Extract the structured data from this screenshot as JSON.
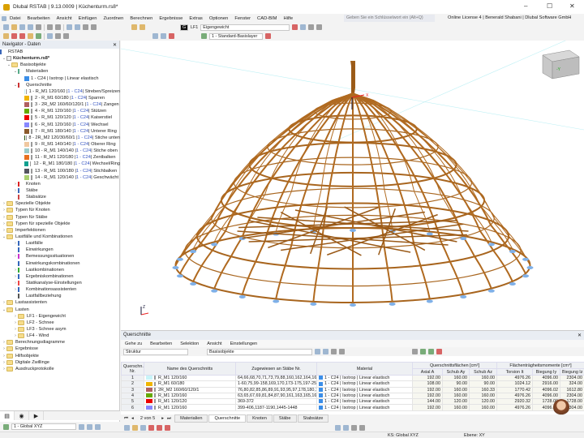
{
  "title": "Dlubal RSTAB | 9.13.0009 | Küchenturm.rs8*",
  "menu": [
    "Datei",
    "Bearbeiten",
    "Ansicht",
    "Einfügen",
    "Zuordnen",
    "Berechnen",
    "Ergebnisse",
    "Extras",
    "Optionen",
    "Fenster",
    "CAD-BIM",
    "Hilfe"
  ],
  "search_placeholder": "Geben Sie ein Schlüsselwort ein (Alt+Q)",
  "license": "Online License 4 | Benerald Shabani | Dlubal Software GmbH",
  "toolbar": {
    "lc_tag": "G",
    "lc": "LF1",
    "lc_name": "Eigengewicht",
    "layer": "1 - Standard-Basislayer"
  },
  "navigator": {
    "title": "Navigator - Daten",
    "root": "RSTAB",
    "file": "Küchenturm.rs8*",
    "basis": "Basisobjekte",
    "materialien": "Materialien",
    "material1": "1 - C24 | Isotrop | Linear elastisch",
    "querschnitte": "Querschnitte",
    "sections": [
      {
        "pre": "1 - R_M1 120/160 | ",
        "mat": "1 - C24",
        "post": " | Streben/Spreizen",
        "color": "#c8f4f8"
      },
      {
        "pre": "2 - R_M1 60/180 | ",
        "mat": "1 - C24",
        "post": " | Sparren",
        "color": "#f0b400"
      },
      {
        "pre": "3 - 2R_M2 160/60/120/1 | ",
        "mat": "1 - C24",
        "post": " | Zangen",
        "color": "#b06060"
      },
      {
        "pre": "4 - R_M1 120/160 | ",
        "mat": "1 - C24",
        "post": " | Stützen",
        "color": "#66aa00"
      },
      {
        "pre": "5 - R_M1 120/120 | ",
        "mat": "1 - C24",
        "post": " | Kaiserstiel",
        "color": "#ee0000"
      },
      {
        "pre": "6 - R_M1 120/160 | ",
        "mat": "1 - C24",
        "post": " | Wechsel",
        "color": "#8888ff"
      },
      {
        "pre": "7 - R_M1 180/140 | ",
        "mat": "1 - C24",
        "post": " | Unterer Ring",
        "color": "#8b5a2b"
      },
      {
        "pre": "8 - 2R_M2 120/30/60/1 | ",
        "mat": "1 - C24",
        "post": " | Stiche unten",
        "color": "#2a5a10"
      },
      {
        "pre": "9 - R_M1 140/140 | ",
        "mat": "1 - C24",
        "post": " | Oberer Ring",
        "color": "#f0c8a0"
      },
      {
        "pre": "10 - R_M1 140/140 | ",
        "mat": "1 - C24",
        "post": " | Stiche oben",
        "color": "#99cccc"
      },
      {
        "pre": "11 - R_M1 120/180 | ",
        "mat": "1 - C24",
        "post": " | Zentbalken",
        "color": "#e87020"
      },
      {
        "pre": "12 - R_M1 180/180 | ",
        "mat": "1 - C24",
        "post": " | Wechsel/Ring",
        "color": "#10a090"
      },
      {
        "pre": "13 - R_M1 100/180 | ",
        "mat": "1 - C24",
        "post": " | Stichbalken",
        "color": "#555560"
      },
      {
        "pre": "14 - R_M1 120/140 | ",
        "mat": "1 - C24",
        "post": " | Geschwächt",
        "color": "#aad070"
      }
    ],
    "knoten": "Knoten",
    "staebe": "Stäbe",
    "stabsaetze": "Stabsätze",
    "folders1": [
      "Spezielle Objekte",
      "Typen für Knoten",
      "Typen für Stäbe",
      "Typen für spezielle Objekte",
      "Imperfektionen",
      "Lastfälle und Kombinationen"
    ],
    "lk_items": [
      "Lastfälle",
      "Einwirkungen",
      "Bemessungssituationen",
      "Einwirkungskombinationen",
      "Lastkombinationen",
      "Ergebniskombinationen",
      "Statikanalyse-Einstellungen",
      "Kombinationsassistenten",
      "Lastfallbeziehung"
    ],
    "lastassistenten": "Lastassistenten",
    "lasten": "Lasten",
    "lasten_items": [
      "LF1 - Eigengewicht",
      "LF2 - Schnee",
      "LF3 - Schnee asym",
      "LF4 - Wind"
    ],
    "folders2": [
      "Berechnungsdiagramme",
      "Ergebnisse",
      "Hilfsobjekte",
      "Digitale Zwillinge",
      "Ausdruckprotokolle"
    ],
    "cs": "1 - Global XYZ"
  },
  "viewport": {
    "cube_y": "-Y",
    "axis_x": "X",
    "axis_z": "Z"
  },
  "panel": {
    "title": "Querschnitte",
    "menu": [
      "Gehe zu",
      "Bearbeiten",
      "Selektion",
      "Ansicht",
      "Einstellungen"
    ],
    "combo1": "Struktur",
    "combo2": "Basisobjekte",
    "headers": {
      "nr": "Querschn. Nr.",
      "name": "Name des Querschnitts",
      "assigned": "Zugewiesen an Stäbe Nr.",
      "material": "Material",
      "areas": "Querschnittsflächen [cm²]",
      "axial": "Axial A",
      "shear_y": "Schub Ay",
      "shear_z": "Schub Az",
      "moments": "Flächenträgheitsmomente [cm⁴]",
      "torsion": "Torsion It",
      "bend_y": "Biegung Iy",
      "bend_z": "Biegung Iz"
    },
    "rows": [
      {
        "nr": "1",
        "color": "#c8f4f8",
        "name": "R_M1 120/160",
        "assigned": "64,66,68,70,71,73,79,88,160,162,164,166...",
        "material": "1 - C24 | Isotrop | Linear elastisch",
        "A": "192.00",
        "Ay": "160.00",
        "Az": "160.00",
        "It": "4976.26",
        "Iy": "4096.00",
        "Iz": "2304.00"
      },
      {
        "nr": "2",
        "color": "#f0b400",
        "name": "R_M1 60/180",
        "assigned": "1-60,75,99-158,169,170,173-175,197-256...",
        "material": "1 - C24 | Isotrop | Linear elastisch",
        "A": "108.00",
        "Ay": "90.00",
        "Az": "90.00",
        "It": "1024.12",
        "Iy": "2916.00",
        "Iz": "324.00"
      },
      {
        "nr": "3",
        "color": "#b06060",
        "name": "2R_M2 160/60/120/1",
        "assigned": "76,80,82,85,86,89,91,93,95,97,178,180,1...",
        "material": "1 - C24 | Isotrop | Linear elastisch",
        "A": "192.00",
        "Ay": "160.00",
        "Az": "160.33",
        "It": "1770.42",
        "Iy": "4096.02",
        "Iz": "1612.80"
      },
      {
        "nr": "4",
        "color": "#66aa00",
        "name": "R_M1 120/160",
        "assigned": "63,65,67,69,81,84,87,90,161,163,165,167...",
        "material": "1 - C24 | Isotrop | Linear elastisch",
        "A": "192.00",
        "Ay": "160.00",
        "Az": "160.00",
        "It": "4976.26",
        "Iy": "4096.00",
        "Iz": "2304.00"
      },
      {
        "nr": "5",
        "color": "#ee0000",
        "name": "R_M1 120/120",
        "assigned": "369-372",
        "material": "1 - C24 | Isotrop | Linear elastisch",
        "A": "144.00",
        "Ay": "120.00",
        "Az": "120.00",
        "It": "2920.32",
        "Iy": "1728.00",
        "Iz": "1728.00"
      },
      {
        "nr": "6",
        "color": "#8888ff",
        "name": "R_M1 120/160",
        "assigned": "399-406,1187-1190,1445-1448",
        "material": "1 - C24 | Isotrop | Linear elastisch",
        "A": "192.00",
        "Ay": "160.00",
        "Az": "160.00",
        "It": "4976.26",
        "Iy": "4096.00",
        "Iz": "2304.00"
      }
    ],
    "pager": "2 von 5",
    "tabs": [
      "Materialien",
      "Querschnitte",
      "Knoten",
      "Stäbe",
      "Stabsätze"
    ]
  },
  "status": {
    "cs": "KS: Global XYZ",
    "plane": "Ebene: XY"
  }
}
